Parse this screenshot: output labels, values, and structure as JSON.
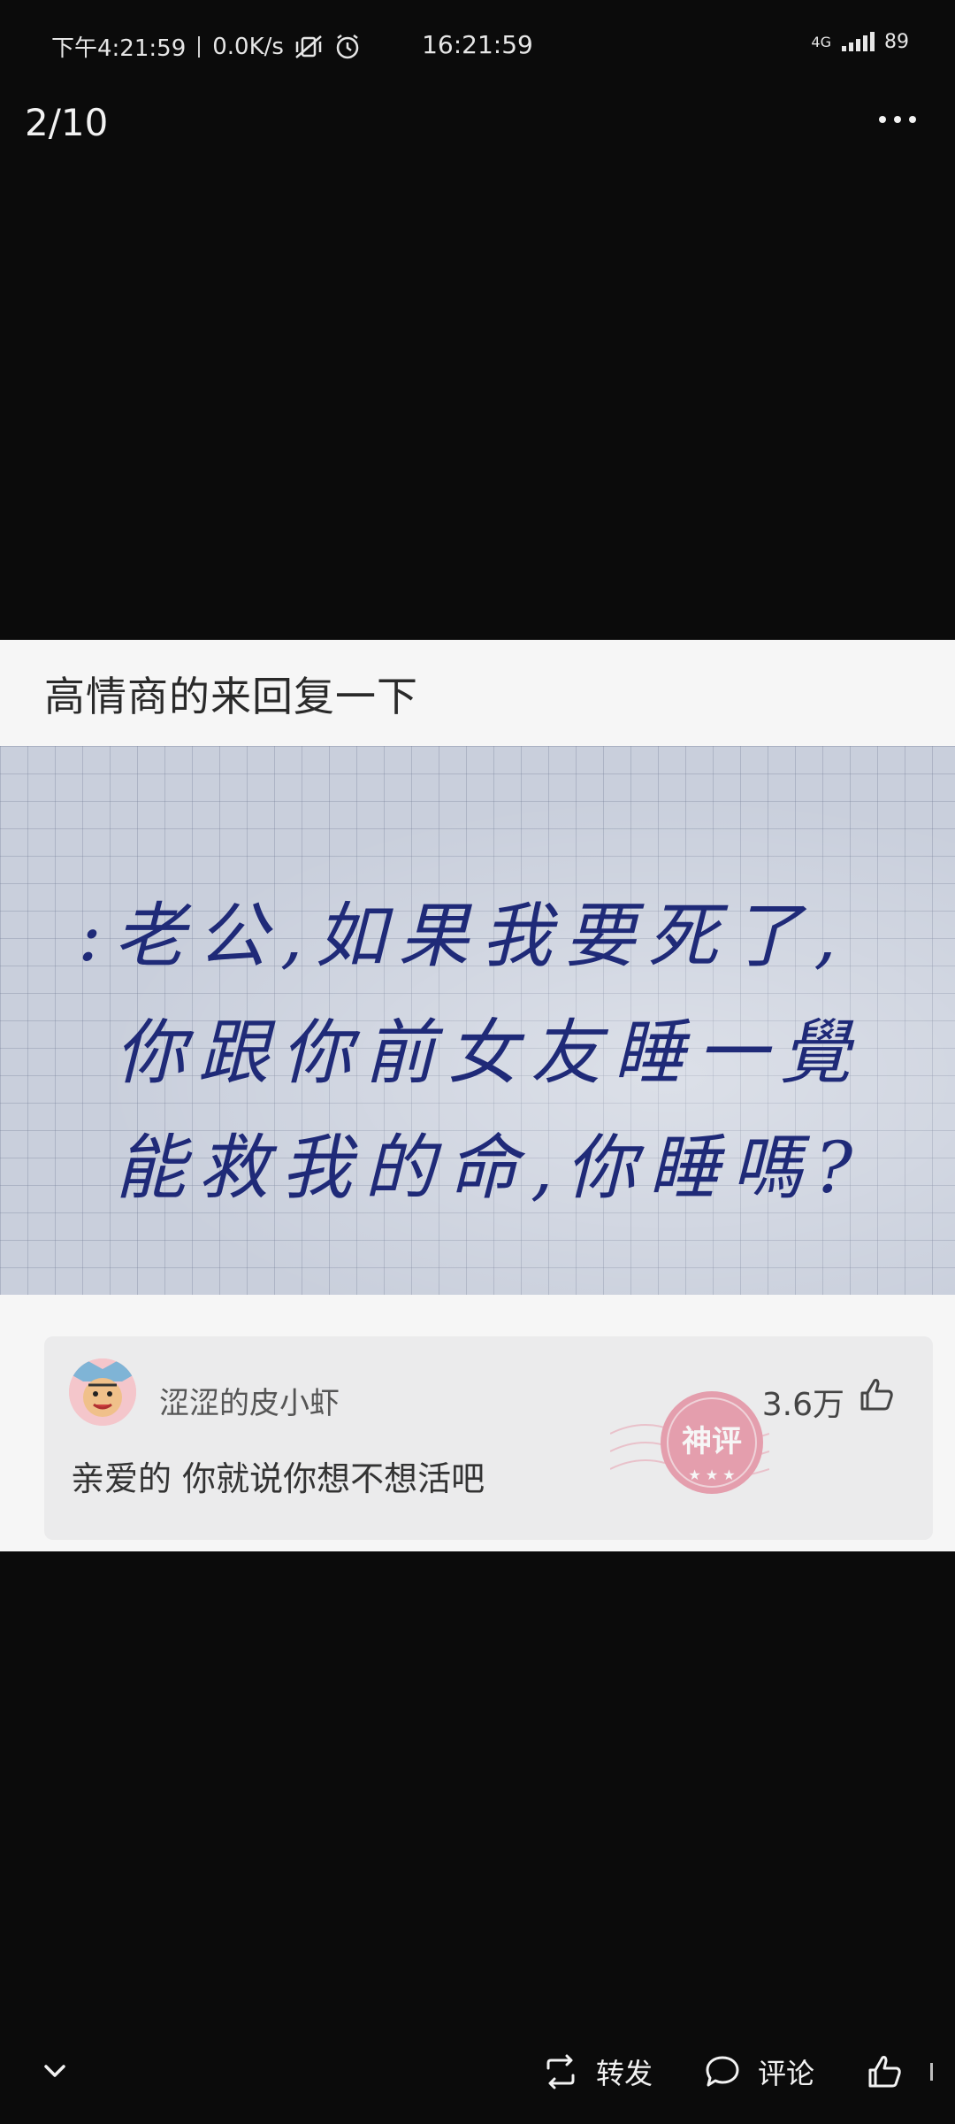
{
  "status_bar": {
    "time_left": "下午4:21:59",
    "network_speed": "0.0K/s",
    "time_center": "16:21:59",
    "network_type": "4G",
    "battery": "89"
  },
  "top_bar": {
    "page_counter": "2/10"
  },
  "post": {
    "title": "高情商的来回复一下",
    "handwriting_lines": [
      ":老公,如果我要死了,",
      "你跟你前女友睡一覺",
      "能救我的命,你睡嗎?"
    ],
    "top_comment": {
      "username": "涩涩的皮小虾",
      "likes": "3.6万",
      "text": "亲爱的 你就说你想不想活吧",
      "stamp_label": "神评"
    }
  },
  "bottom_bar": {
    "forward_label": "转发",
    "comment_label": "评论"
  },
  "colors": {
    "background": "#0b0b0b",
    "card": "#f6f6f6",
    "ink": "#1f2a78",
    "stamp": "#e0607a"
  }
}
